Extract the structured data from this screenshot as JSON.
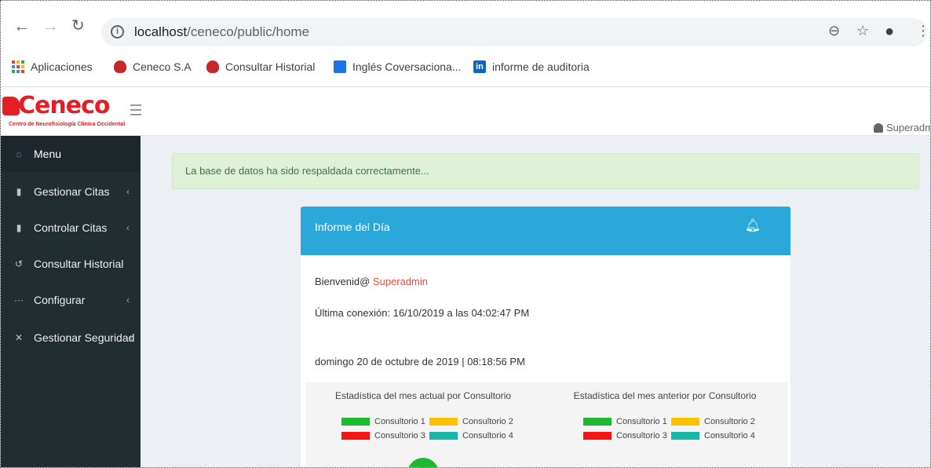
{
  "browser": {
    "url_host": "localhost",
    "url_path": "/ceneco/public/home",
    "bookmarks": [
      {
        "label": "Aplicaciones"
      },
      {
        "label": "Ceneco S.A"
      },
      {
        "label": "Consultar Historial"
      },
      {
        "label": "Inglés Coversaciona..."
      },
      {
        "label": "informe de auditoria"
      }
    ]
  },
  "brand": {
    "name": "Ceneco",
    "subtitle": "Centro de Neurofisiología Clínica Occidental"
  },
  "header": {
    "user": "Superadm"
  },
  "sidebar": {
    "items": [
      {
        "label": "Menu"
      },
      {
        "label": "Gestionar Citas"
      },
      {
        "label": "Controlar Citas"
      },
      {
        "label": "Consultar Historial"
      },
      {
        "label": "Configurar"
      },
      {
        "label": "Gestionar Seguridad"
      }
    ]
  },
  "alert": {
    "message": "La base de datos ha sido respaldada correctamente..."
  },
  "report": {
    "title": "Informe del Día",
    "welcome_prefix": "Bienvenid@ ",
    "welcome_user": "Superadmin",
    "last_connection": "Última conexión: 16/10/2019 a las 04:02:47 PM",
    "date_time": "domingo 20 de octubre de 2019 | 08:18:56 PM"
  },
  "stats": {
    "current_title": "Estadística del mes actual por Consultorio",
    "previous_title": "Estadística del mes anterior por Consultorio",
    "legend": [
      {
        "label": "Consultorio 1",
        "color": "#1db92e"
      },
      {
        "label": "Consultorio 2",
        "color": "#ffc200"
      },
      {
        "label": "Consultorio 3",
        "color": "#f51515"
      },
      {
        "label": "Consultorio 4",
        "color": "#17b6a8"
      }
    ]
  },
  "colors": {
    "sidebar_bg": "#222d32",
    "panel_header": "#29a8d9",
    "brand_red": "#e31e24",
    "alert_bg": "#dff0d8"
  }
}
